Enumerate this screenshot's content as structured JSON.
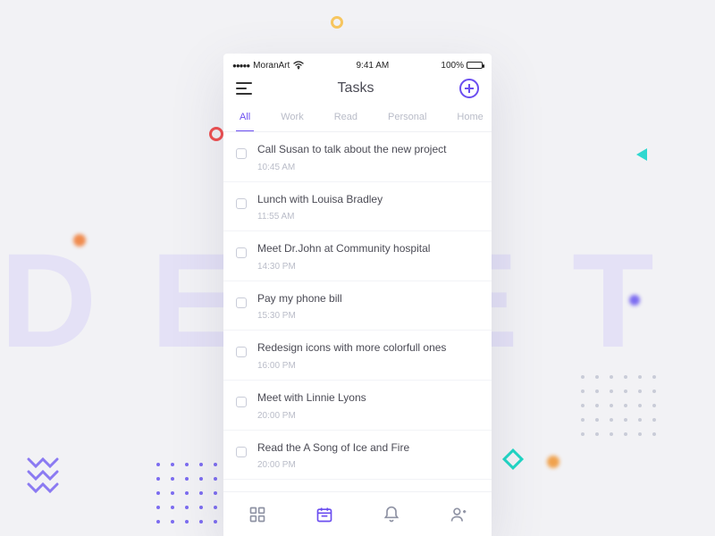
{
  "background_word": "DELETE",
  "statusbar": {
    "carrier": "MoranArt",
    "time": "9:41 AM",
    "battery": "100%"
  },
  "header": {
    "title": "Tasks"
  },
  "tabs": [
    "All",
    "Work",
    "Read",
    "Personal",
    "Home"
  ],
  "active_tab_index": 0,
  "tasks": [
    {
      "title": "Call Susan to talk about the new project",
      "time": "10:45 AM"
    },
    {
      "title": "Lunch with Louisa Bradley",
      "time": "11:55 AM"
    },
    {
      "title": "Meet Dr.John at Community hospital",
      "time": "14:30 PM"
    },
    {
      "title": "Pay my phone bill",
      "time": "15:30 PM"
    },
    {
      "title": "Redesign icons with more colorfull ones",
      "time": "16:00 PM"
    },
    {
      "title": "Meet with Linnie Lyons",
      "time": "20:00 PM"
    },
    {
      "title": "Read the A Song of Ice and Fire",
      "time": "20:00 PM"
    }
  ],
  "nav_active_index": 1
}
